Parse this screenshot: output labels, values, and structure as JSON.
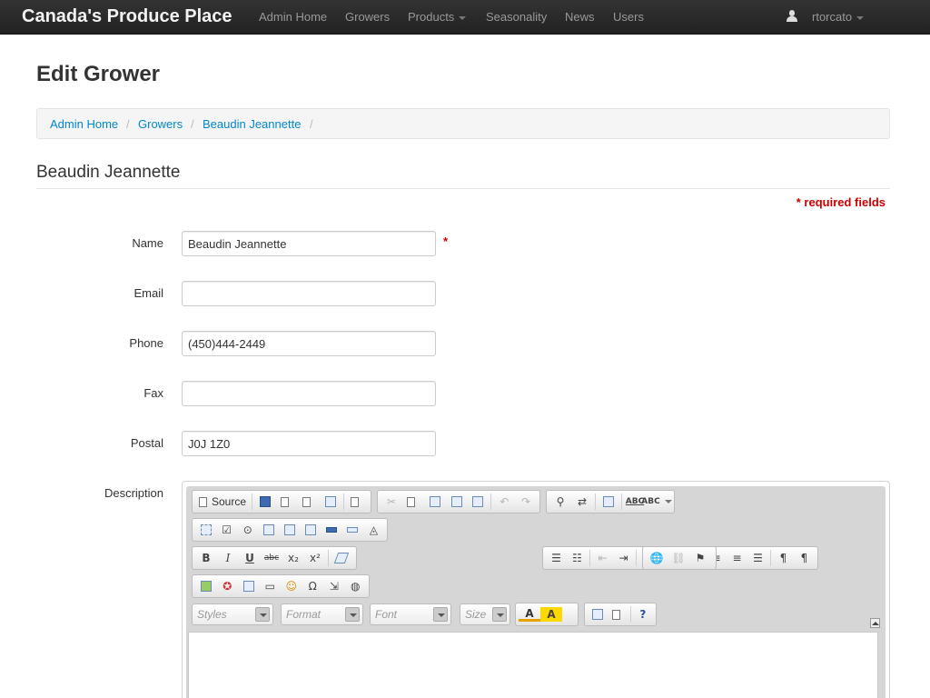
{
  "navbar": {
    "brand": "Canada's Produce Place",
    "items": [
      {
        "label": "Admin Home"
      },
      {
        "label": "Growers"
      },
      {
        "label": "Products",
        "dropdown": true
      },
      {
        "label": "Seasonality"
      },
      {
        "label": "News"
      },
      {
        "label": "Users"
      }
    ],
    "user": {
      "name": "rtorcato",
      "icon": "user-icon"
    }
  },
  "page": {
    "title": "Edit Grower",
    "breadcrumb": [
      "Admin Home",
      "Growers",
      "Beaudin Jeannette"
    ],
    "breadcrumb_separator": "/",
    "section_title": "Beaudin Jeannette",
    "required_note": "* required fields"
  },
  "form": {
    "name": {
      "label": "Name",
      "value": "Beaudin Jeannette",
      "required_mark": "*"
    },
    "email": {
      "label": "Email",
      "value": ""
    },
    "phone": {
      "label": "Phone",
      "value": "(450)444-2449"
    },
    "fax": {
      "label": "Fax",
      "value": ""
    },
    "postal": {
      "label": "Postal",
      "value": "J0J 1Z0"
    },
    "description": {
      "label": "Description",
      "value": ""
    }
  },
  "editor": {
    "source_label": "Source",
    "combos": [
      {
        "label": "Styles"
      },
      {
        "label": "Format"
      },
      {
        "label": "Font"
      },
      {
        "label": "Size"
      }
    ],
    "glyphs": {
      "bold": "B",
      "italic": "I",
      "underline": "U",
      "strike": "abc",
      "subscript": "x₂",
      "superscript": "x²",
      "spell": "ABC",
      "help": "?",
      "text_color": "A",
      "bg_color": "A",
      "omega": "Ω",
      "quote": "❞"
    }
  },
  "colors": {
    "link": "#0088cc",
    "required": "#cc0000",
    "navbar": "#222222"
  }
}
